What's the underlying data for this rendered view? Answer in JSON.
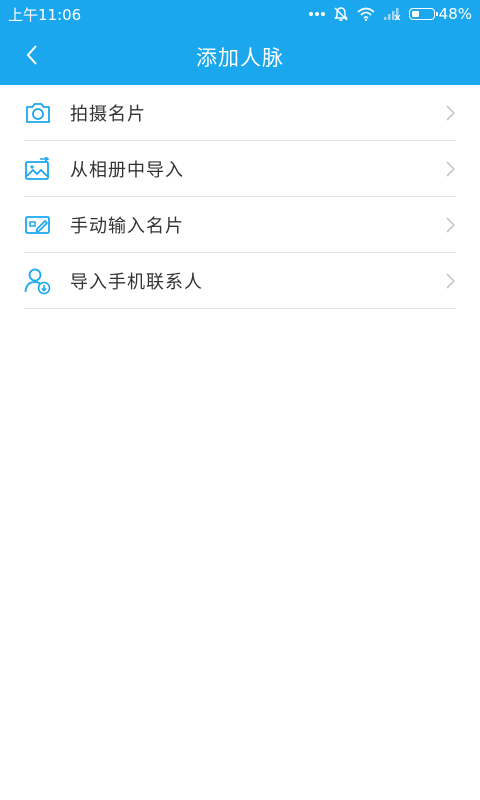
{
  "status": {
    "time": "上午11:06",
    "battery_text": "48%",
    "battery_level": 0.48
  },
  "header": {
    "title": "添加人脉",
    "back_icon": "chevron-left-icon"
  },
  "menu": {
    "items": [
      {
        "label": "拍摄名片",
        "icon": "camera-icon"
      },
      {
        "label": "从相册中导入",
        "icon": "photo-album-icon"
      },
      {
        "label": "手动输入名片",
        "icon": "edit-card-icon"
      },
      {
        "label": "导入手机联系人",
        "icon": "contact-import-icon"
      }
    ]
  },
  "colors": {
    "primary": "#1ba7ee",
    "text": "#333333",
    "divider": "#e2e2e2",
    "chevron": "#c8c8c8"
  }
}
